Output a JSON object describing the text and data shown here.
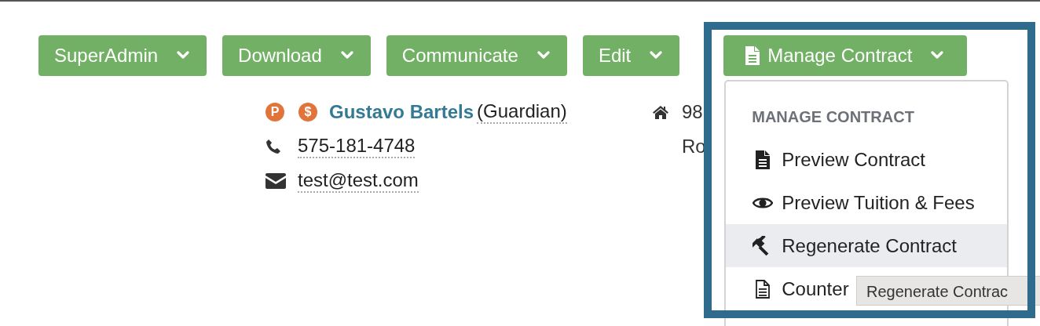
{
  "toolbar": {
    "buttons": [
      {
        "label": "SuperAdmin",
        "kind": "plain"
      },
      {
        "label": "Download",
        "kind": "plain"
      },
      {
        "label": "Communicate",
        "kind": "plain"
      },
      {
        "label": "Edit",
        "kind": "plain"
      },
      {
        "label": "Manage Contract",
        "kind": "document"
      }
    ]
  },
  "contact": {
    "badges": [
      {
        "text": "P",
        "color": "#e0743a"
      },
      {
        "text": "$",
        "color": "#e0743a"
      }
    ],
    "name": "Gustavo Bartels",
    "role": "(Guardian)",
    "phone": "575-181-4748",
    "email": "test@test.com"
  },
  "address": {
    "line_1": "98",
    "line_2": "Ro"
  },
  "dropdown_menu": {
    "header": "MANAGE CONTRACT",
    "items": [
      {
        "label": "Preview Contract",
        "kind": "file-solid",
        "selected": false
      },
      {
        "label": "Preview Tuition & Fees",
        "kind": "eye",
        "selected": false
      },
      {
        "label": "Regenerate Contract",
        "kind": "gavel",
        "selected": true
      },
      {
        "label": "Counter",
        "kind": "file-outline",
        "selected": false
      }
    ]
  },
  "tooltip": {
    "text": "Regenerate Contrac"
  }
}
